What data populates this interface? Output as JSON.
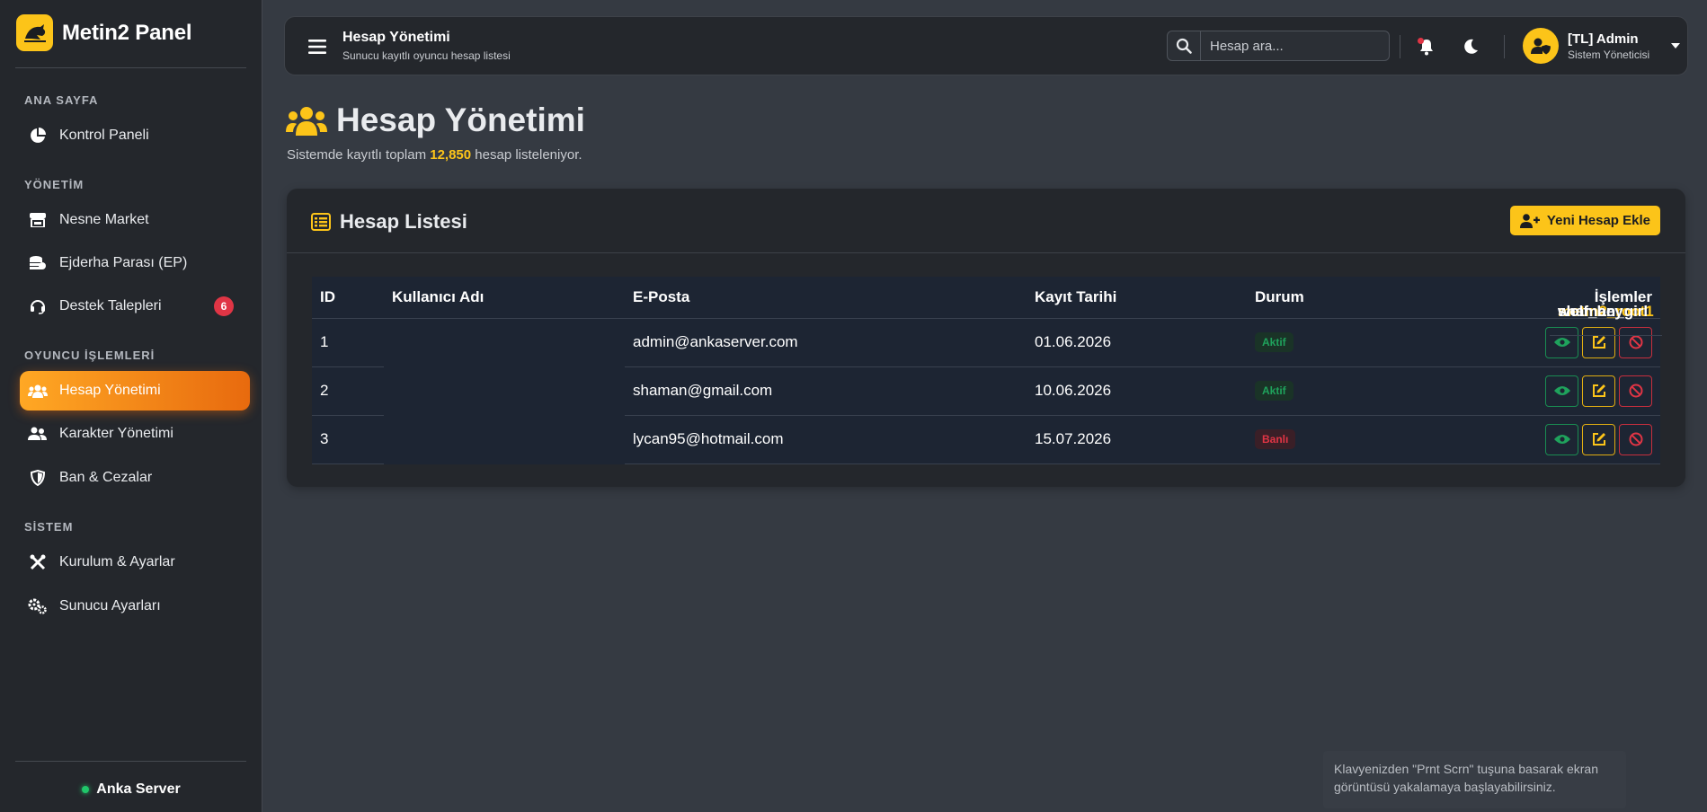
{
  "brand": {
    "name": "Metin2 Panel"
  },
  "sidebar": {
    "sections": [
      {
        "title": "ANA SAYFA"
      },
      {
        "title": "YÖNETİM"
      },
      {
        "title": "OYUNCU İŞLEMLERİ"
      },
      {
        "title": "SİSTEM"
      }
    ],
    "items": [
      {
        "label": "Kontrol Paneli",
        "icon": "chart-pie-icon"
      },
      {
        "label": "Nesne Market",
        "icon": "store-icon"
      },
      {
        "label": "Ejderha Parası (EP)",
        "icon": "coins-icon"
      },
      {
        "label": "Destek Talepleri",
        "icon": "headset-icon",
        "badge": "6"
      },
      {
        "label": "Hesap Yönetimi",
        "icon": "users-icon",
        "active": true
      },
      {
        "label": "Karakter Yönetimi",
        "icon": "user-friends-icon"
      },
      {
        "label": "Ban & Cezalar",
        "icon": "shield-icon"
      },
      {
        "label": "Kurulum & Ayarlar",
        "icon": "tools-icon"
      },
      {
        "label": "Sunucu Ayarları",
        "icon": "cogs-icon"
      }
    ],
    "server": "Anka Server"
  },
  "header": {
    "title": "Hesap Yönetimi",
    "subtitle": "Sunucu kayıtlı oyuncu hesap listesi",
    "search_placeholder": "Hesap ara...",
    "user_name": "[TL] Admin",
    "user_role": "Sistem Yöneticisi"
  },
  "page": {
    "title": "Hesap Yönetimi",
    "sub_before": "Sistemde kayıtlı toplam",
    "total": "12,850",
    "sub_after": "hesap listeleniyor."
  },
  "card": {
    "title": "Hesap Listesi",
    "add_button": "Yeni Hesap Ekle"
  },
  "table": {
    "headers": [
      "ID",
      "Kullanıcı Adı",
      "E-Posta",
      "Kayıt Tarihi",
      "Durum",
      "İşlemler"
    ],
    "rows": [
      {
        "id": "1",
        "username": "metin2_root1",
        "email": "admin@ankaserver.com",
        "date": "01.06.2026",
        "status": "Aktif"
      },
      {
        "id": "2",
        "username": "shaman_girl",
        "email": "shaman@gmail.com",
        "date": "10.06.2026",
        "status": "Aktif"
      },
      {
        "id": "3",
        "username": "wolf_bey",
        "email": "lycan95@hotmail.com",
        "date": "15.07.2026",
        "status": "Banlı"
      }
    ]
  },
  "tooltip": "Klavyenizden \"Prnt Scrn\" tuşuna basarak ekran görüntüsü yakalamaya başlayabilirsiniz.",
  "colors": {
    "accent": "#fcc419",
    "active_start": "#ffa824",
    "active_end": "#e86a0e",
    "success": "#1fa25c",
    "danger": "#e03545"
  }
}
